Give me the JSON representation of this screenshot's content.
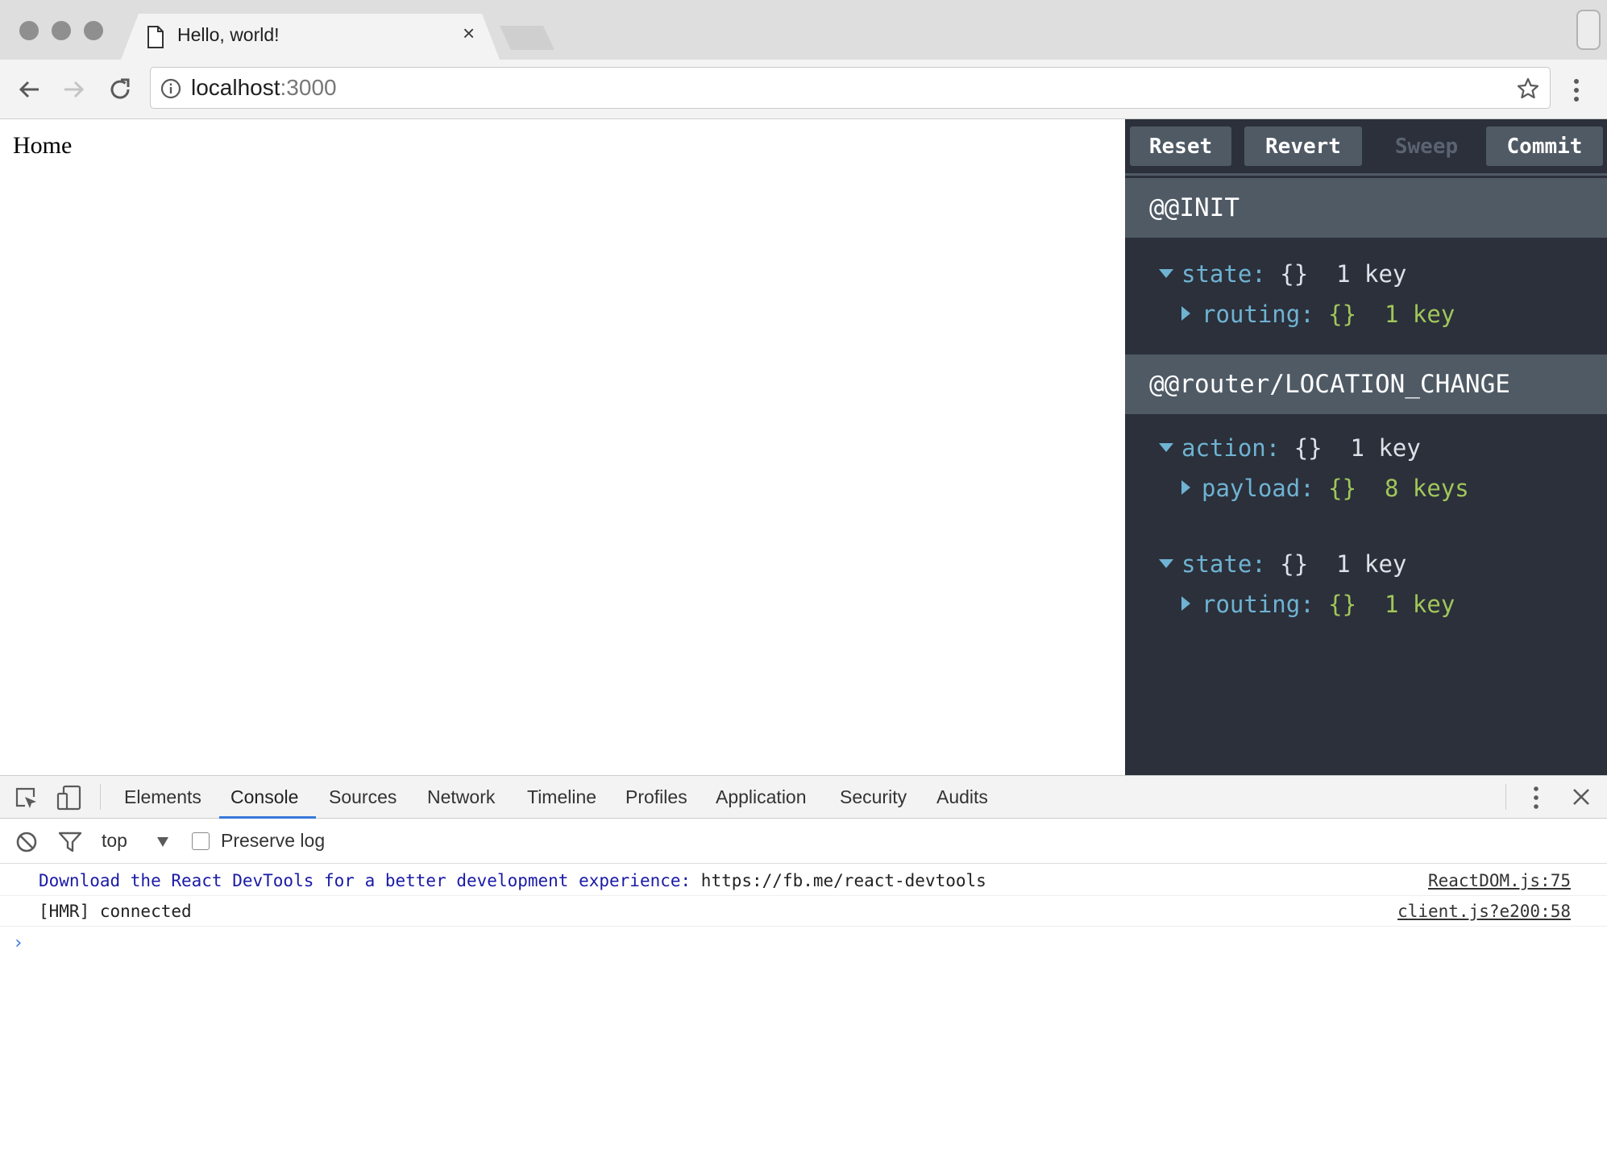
{
  "browser": {
    "tab_title": "Hello, world!",
    "tab_close": "×",
    "url_host": "localhost",
    "url_port": ":3000"
  },
  "page": {
    "content": "Home"
  },
  "redux_devtools": {
    "buttons": {
      "reset": "Reset",
      "revert": "Revert",
      "sweep": "Sweep",
      "commit": "Commit"
    },
    "actions": [
      {
        "name": "@@INIT",
        "state_key": "state:",
        "state_braces": "{}",
        "state_count": "1 key",
        "routing_key": "routing:",
        "routing_braces": "{}",
        "routing_count": "1 key"
      },
      {
        "name": "@@router/LOCATION_CHANGE",
        "action_key": "action:",
        "action_braces": "{}",
        "action_count": "1 key",
        "payload_key": "payload:",
        "payload_braces": "{}",
        "payload_count": "8 keys",
        "state_key": "state:",
        "state_braces": "{}",
        "state_count": "1 key",
        "routing_key": "routing:",
        "routing_braces": "{}",
        "routing_count": "1 key"
      }
    ]
  },
  "devtools": {
    "tabs": [
      "Elements",
      "Console",
      "Sources",
      "Network",
      "Timeline",
      "Profiles",
      "Application",
      "Security",
      "Audits"
    ],
    "active_tab": "Console",
    "context": "top",
    "preserve_log": "Preserve log",
    "console": [
      {
        "text": "Download the React DevTools for a better development experience:",
        "link": " https://fb.me/react-devtools",
        "source": "ReactDOM.js:75"
      },
      {
        "text": "[HMR] connected",
        "source": "client.js?e200:58"
      }
    ],
    "prompt": "›"
  },
  "colors": {
    "redux_bg": "#2b303b",
    "redux_header": "#4f5a65",
    "key_blue": "#6fb3d2",
    "value_green": "#a1c659",
    "devtools_accent": "#3879d9"
  }
}
